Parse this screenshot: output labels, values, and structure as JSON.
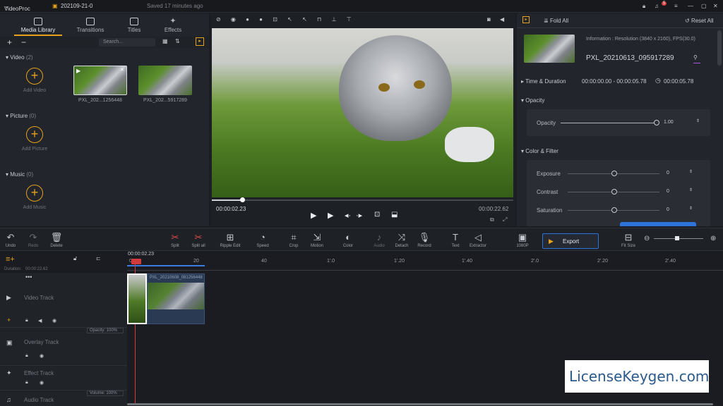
{
  "app": {
    "name": "VideoProc",
    "project": "202109-21-0",
    "saved": "Saved 17 minutes ago",
    "notif_count": "5"
  },
  "library": {
    "tabs": [
      "Media Library",
      "Transitions",
      "Titles",
      "Effects"
    ],
    "search_placeholder": "Search...",
    "video": {
      "label": "Video",
      "count": "(2)",
      "add": "Add Video",
      "clips": [
        "PXL_202...1256448",
        "PXL_202...5917289"
      ]
    },
    "picture": {
      "label": "Picture",
      "count": "(0)",
      "add": "Add Picture"
    },
    "music": {
      "label": "Music",
      "count": "(0)",
      "add": "Add Music"
    }
  },
  "preview": {
    "time_current": "00:00:02.23",
    "time_total": "00:00:22.62",
    "progress": 0.1
  },
  "inspector": {
    "fold_all": "Fold All",
    "reset_all": "Reset All",
    "info": "Information : Resolution (3840 x 2160), FPS(30.0)",
    "filename": "PXL_20210613_095917289",
    "time_section": "Time & Duration",
    "time_range": "00:00:00.00 - 00:00:05.78",
    "duration": "00:00:05.78",
    "opacity_section": "Opacity",
    "opacity_label": "Opacity",
    "opacity_value": "1.00",
    "color_section": "Color & Filter",
    "exposure_label": "Exposure",
    "exposure_value": "0",
    "contrast_label": "Contrast",
    "contrast_value": "0",
    "saturation_label": "Saturation",
    "saturation_value": "0"
  },
  "toolbar": {
    "undo": "Undo",
    "redo": "Redo",
    "delete": "Delete",
    "split": "Split",
    "split_all": "Split all",
    "ripple": "Ripple Edit",
    "speed": "Speed",
    "crop": "Crop",
    "motion": "Motion",
    "color": "Color",
    "audio": "Audio",
    "detach": "Detach",
    "record": "Record",
    "text": "Text",
    "extractor": "Extractor",
    "resolution": "1080P",
    "export": "Export",
    "fit_size": "Fit Size"
  },
  "timeline": {
    "playhead_time": "00:00:02.23",
    "duration_label": "Duration:",
    "duration_value": "00:00:22.62",
    "ruler": [
      "0",
      "20",
      "40",
      "1'.0",
      "1'.20",
      "1'.40",
      "2'.0",
      "2'.20",
      "2'.40"
    ],
    "clip_name": "PXL_20210608_081256448",
    "tracks": [
      "Video Track",
      "Overlay Track",
      "Effect Track",
      "Audio Track"
    ],
    "opacity_badge": "Opacity: 100%",
    "volume_badge": "Volume: 100%"
  },
  "watermark": "LicenseKeygen.com"
}
